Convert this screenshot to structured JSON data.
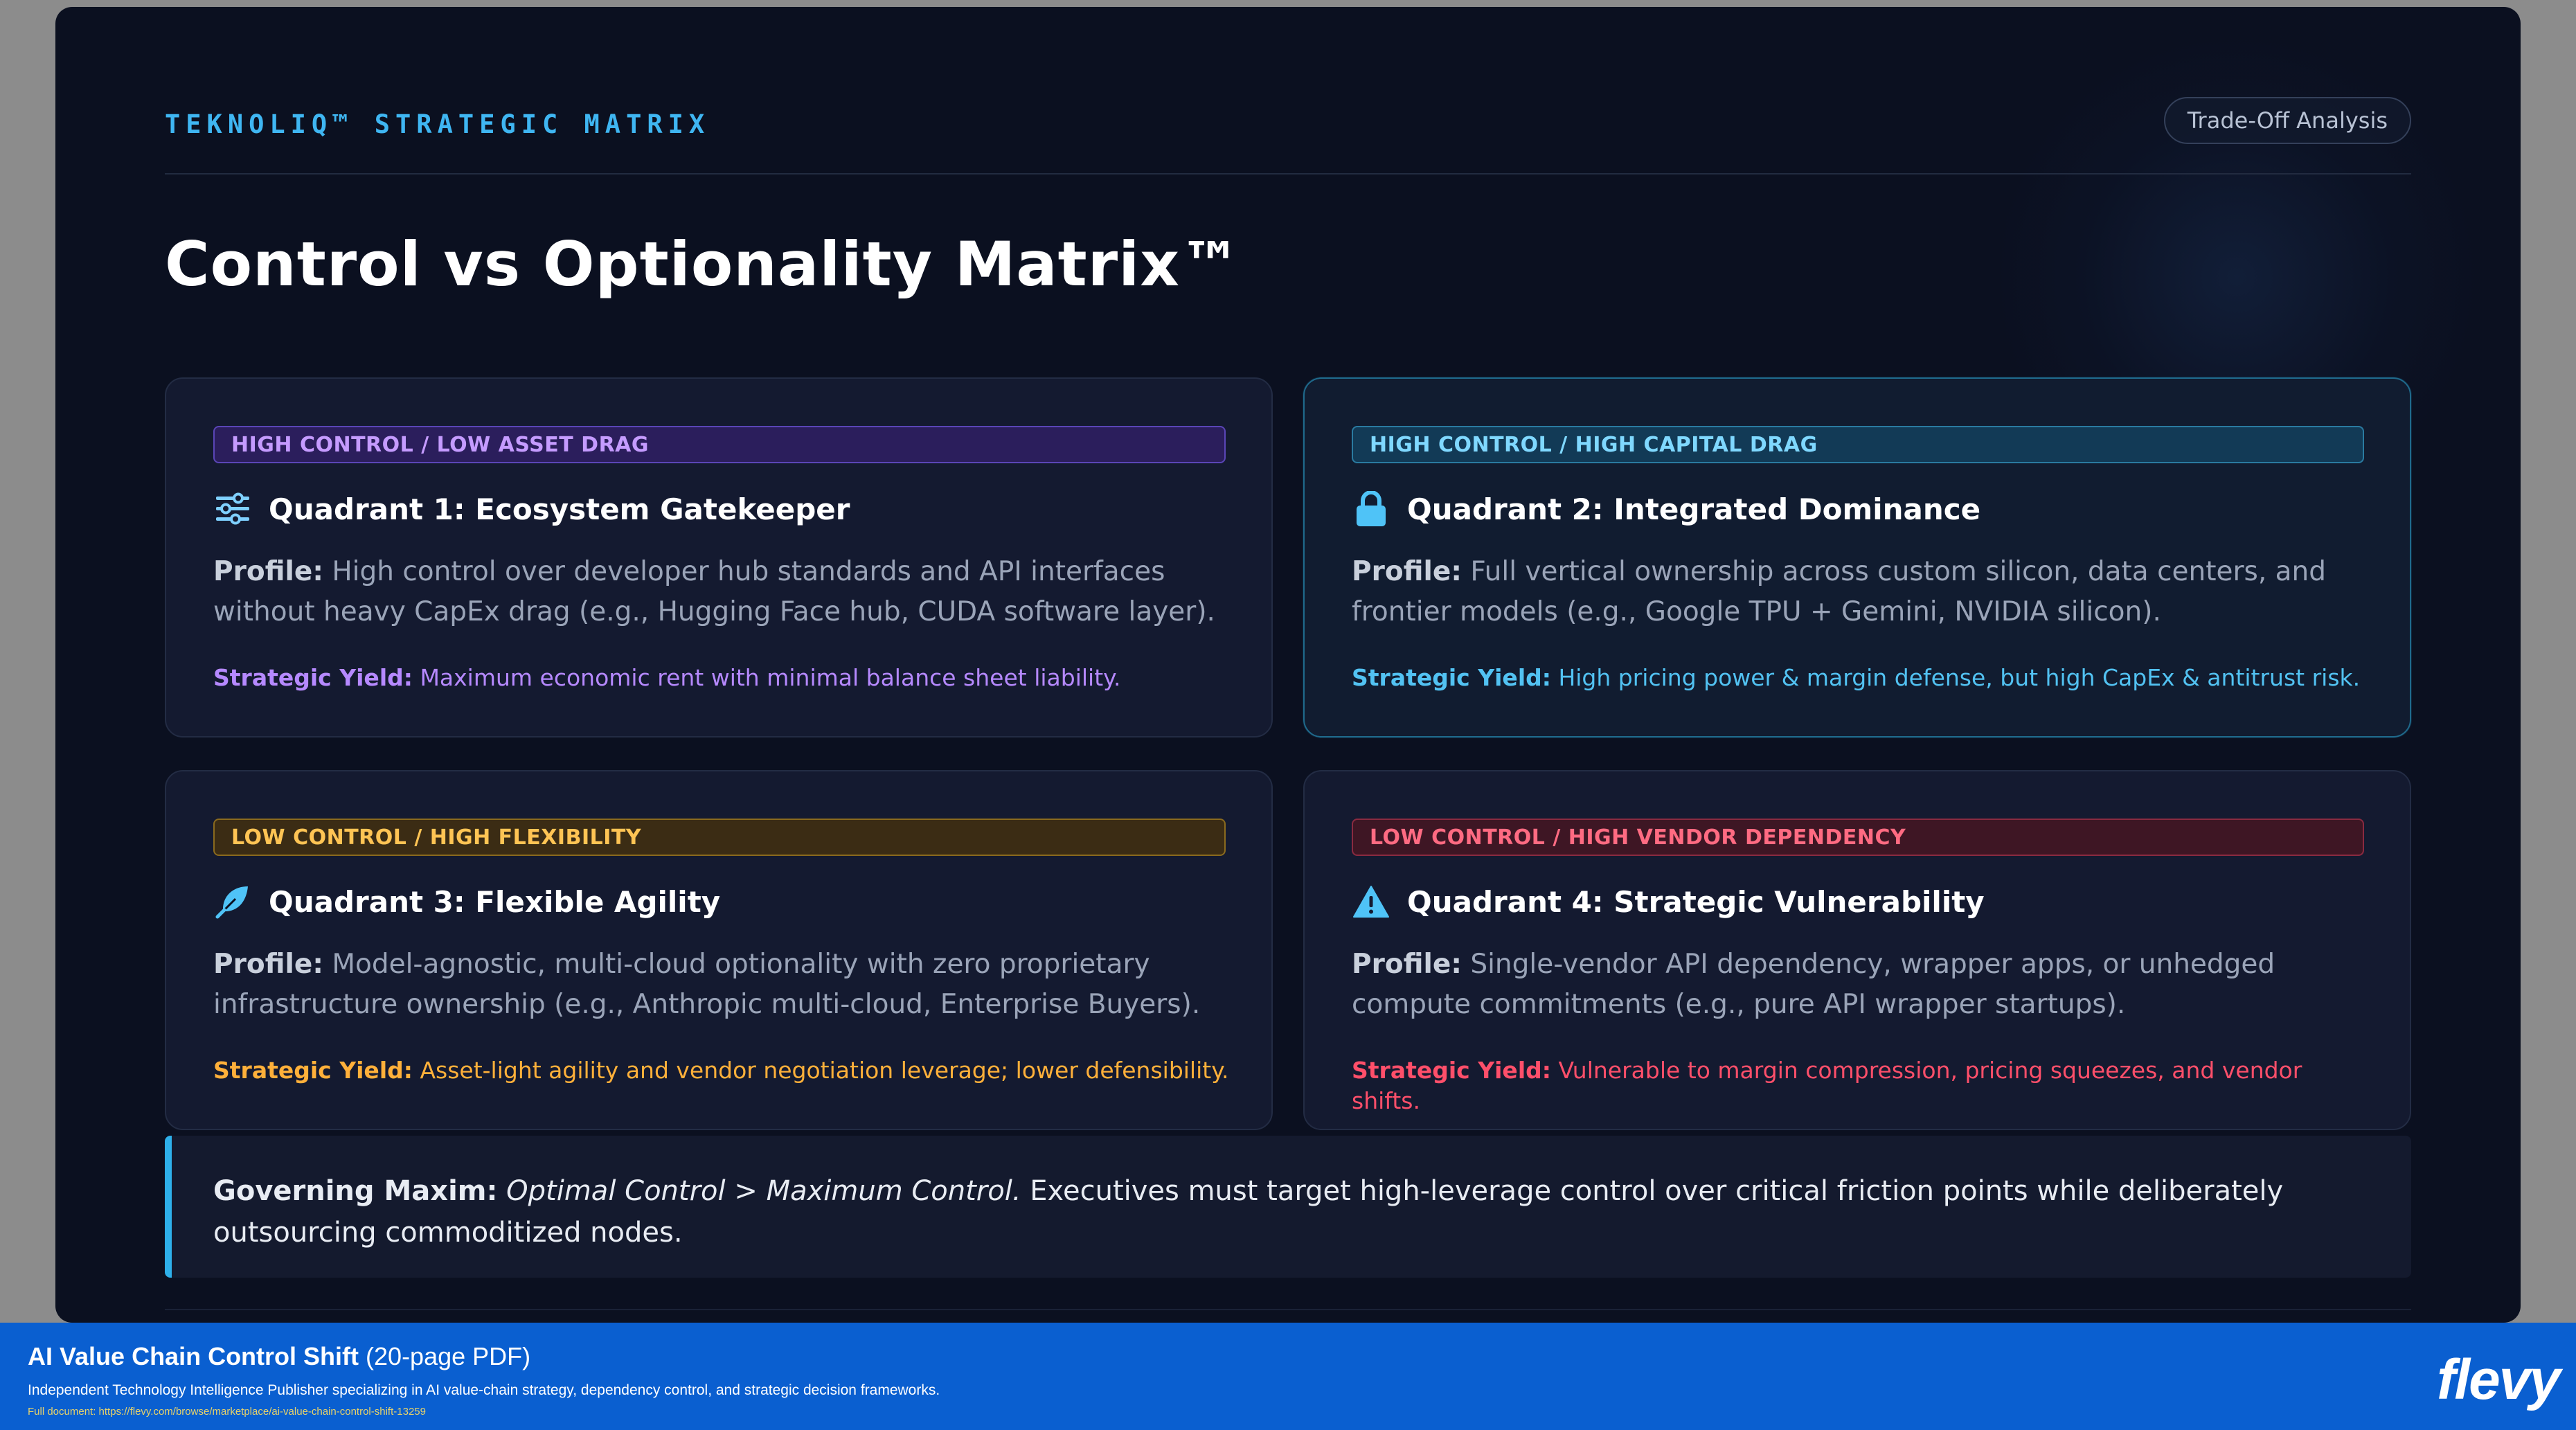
{
  "header": {
    "brand": "TEKNOLIQ™ STRATEGIC MATRIX",
    "pill": "Trade-Off Analysis",
    "title": "Control vs Optionality Matrix™"
  },
  "quadrants": [
    {
      "tag": "HIGH CONTROL / LOW ASSET DRAG",
      "title": "Quadrant 1: Ecosystem Gatekeeper",
      "icon": "sliders-icon",
      "profile_label": "Profile:",
      "profile_text": " High control over developer hub standards and API interfaces without heavy CapEx drag (e.g., Hugging Face hub, CUDA software layer).",
      "yield_label": "Strategic Yield:",
      "yield_text": " Maximum economic rent with minimal balance sheet liability.",
      "accent": "#b689ff"
    },
    {
      "tag": "HIGH CONTROL / HIGH CAPITAL DRAG",
      "title": "Quadrant 2: Integrated Dominance",
      "icon": "lock-icon",
      "profile_label": "Profile:",
      "profile_text": " Full vertical ownership across custom silicon, data centers, and frontier models (e.g., Google TPU + Gemini, NVIDIA silicon).",
      "yield_label": "Strategic Yield:",
      "yield_text": " High pricing power & margin defense, but high CapEx & antitrust risk.",
      "accent": "#52c2f2"
    },
    {
      "tag": "LOW CONTROL / HIGH FLEXIBILITY",
      "title": "Quadrant 3: Flexible Agility",
      "icon": "feather-icon",
      "profile_label": "Profile:",
      "profile_text": " Model-agnostic, multi-cloud optionality with zero proprietary infrastructure ownership (e.g., Anthropic multi-cloud, Enterprise Buyers).",
      "yield_label": "Strategic Yield:",
      "yield_text": " Asset-light agility and vendor negotiation leverage; lower defensibility.",
      "accent": "#ffb03a"
    },
    {
      "tag": "LOW CONTROL / HIGH VENDOR DEPENDENCY",
      "title": "Quadrant 4: Strategic Vulnerability",
      "icon": "warning-icon",
      "profile_label": "Profile:",
      "profile_text": " Single-vendor API dependency, wrapper apps, or unhedged compute commitments (e.g., pure API wrapper startups).",
      "yield_label": "Strategic Yield:",
      "yield_text": " Vulnerable to margin compression, pricing squeezes, and vendor shifts.",
      "accent": "#ff4f6a"
    }
  ],
  "maxim": {
    "label": "Governing Maxim:",
    "italic": "Optimal Control > Maximum Control.",
    "text": " Executives must target high-leverage control over critical friction points while deliberately outsourcing commoditized nodes."
  },
  "footer": {
    "title": "AI Value Chain Control Shift",
    "pages": " (20-page PDF)",
    "subtitle": "Independent Technology Intelligence Publisher specializing in AI value-chain strategy, dependency control, and strategic decision frameworks.",
    "url": "Full document: https://flevy.com/browse/marketplace/ai-value-chain-control-shift-13259",
    "logo": "flevy"
  }
}
